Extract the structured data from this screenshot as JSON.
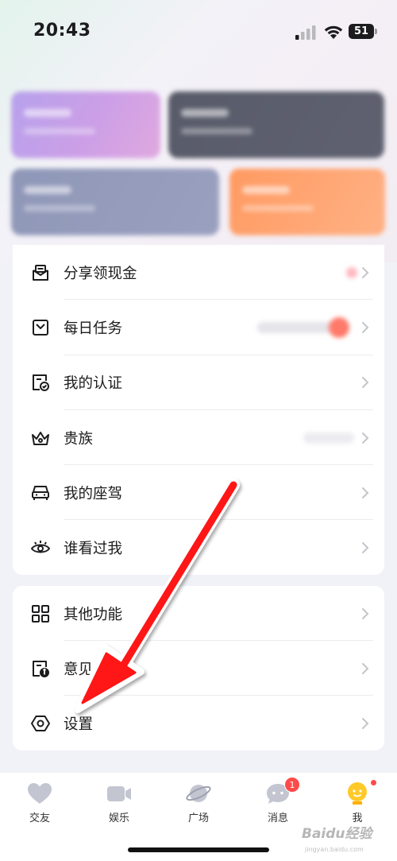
{
  "status_bar": {
    "time": "20:43",
    "battery": "51"
  },
  "menu_group_1": [
    {
      "label": "分享领现金",
      "icon": "envelope-icon"
    },
    {
      "label": "每日任务",
      "icon": "task-calendar-icon"
    },
    {
      "label": "我的认证",
      "icon": "certification-icon"
    },
    {
      "label": "贵族",
      "icon": "crown-icon"
    },
    {
      "label": "我的座驾",
      "icon": "car-icon"
    },
    {
      "label": "谁看过我",
      "icon": "eye-icon"
    }
  ],
  "menu_group_2": [
    {
      "label": "其他功能",
      "icon": "grid-icon"
    },
    {
      "label": "意见反馈",
      "icon": "feedback-icon"
    },
    {
      "label": "设置",
      "icon": "settings-hexagon-icon"
    }
  ],
  "tab_bar": [
    {
      "label": "交友",
      "icon": "heart-icon",
      "active": false
    },
    {
      "label": "娱乐",
      "icon": "video-camera-icon",
      "active": false
    },
    {
      "label": "广场",
      "icon": "planet-icon",
      "active": false
    },
    {
      "label": "消息",
      "icon": "chat-bubble-icon",
      "active": false,
      "badge": "1"
    },
    {
      "label": "我",
      "icon": "profile-face-icon",
      "active": true,
      "dot": true
    }
  ],
  "watermark": {
    "text": "Baidu经验",
    "sub": "jingyan.baidu.com"
  },
  "colors": {
    "accent_red": "#ff4a4a",
    "active_tab_yellow": "#ffc928",
    "arrow_red": "#ff1414"
  }
}
